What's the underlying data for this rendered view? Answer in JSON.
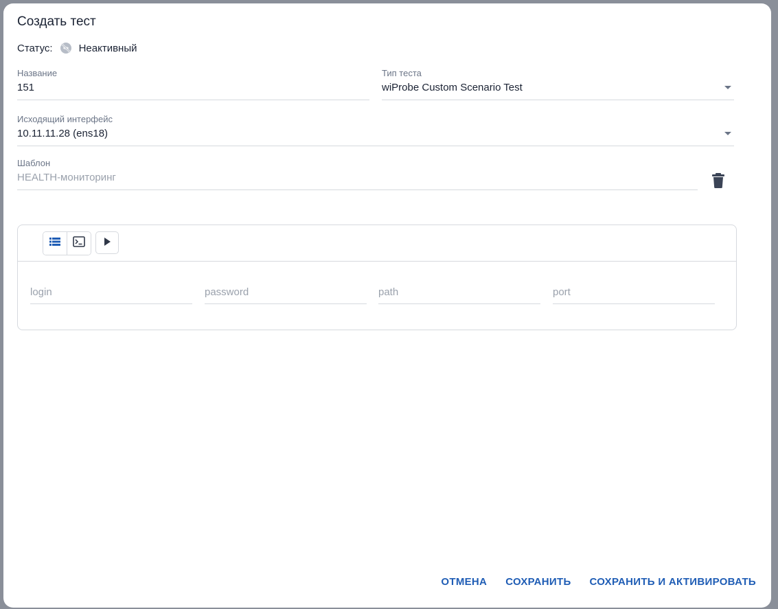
{
  "dialog": {
    "title": "Создать тест",
    "status_label": "Статус:",
    "status_value": "Неактивный",
    "status_icon": "inactive-icon"
  },
  "fields": {
    "name": {
      "label": "Название",
      "value": "151"
    },
    "test_type": {
      "label": "Тип теста",
      "value": "wiProbe Custom Scenario Test"
    },
    "interface": {
      "label": "Исходящий интерфейс",
      "value": "10.11.11.28 (ens18)"
    },
    "template": {
      "label": "Шаблон",
      "value": "HEALTH-мониторинг"
    }
  },
  "panel": {
    "toolbar_icons": [
      "list-icon",
      "terminal-icon",
      "play-icon"
    ],
    "params": [
      "login",
      "password",
      "path",
      "port"
    ]
  },
  "actions": {
    "cancel": "ОТМЕНА",
    "save": "СОХРАНИТЬ",
    "save_activate": "СОХРАНИТЬ И АКТИВИРОВАТЬ"
  },
  "colors": {
    "accent": "#1f5db5",
    "text": "#1a2233",
    "muted": "#9aa1ac",
    "border": "#d6d9de"
  }
}
